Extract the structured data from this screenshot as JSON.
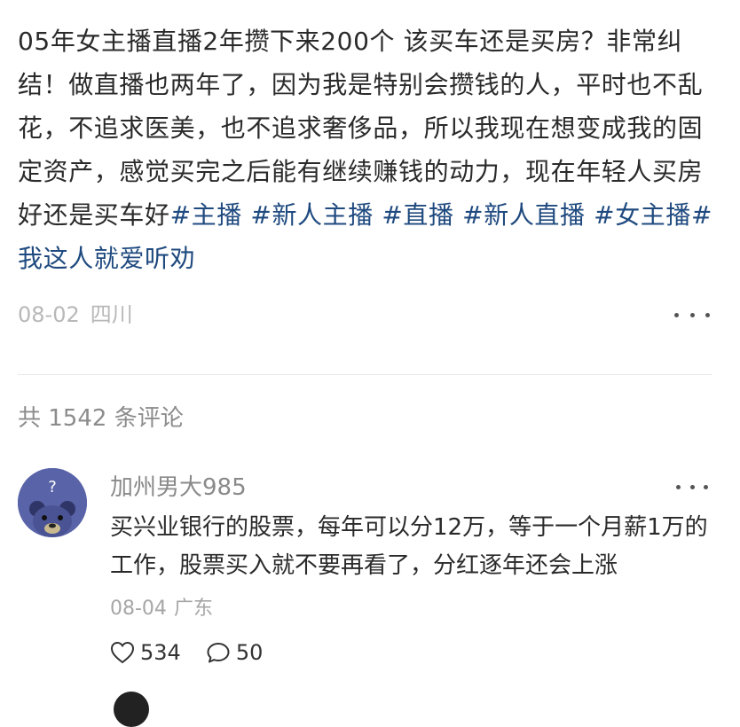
{
  "post": {
    "text": "05年女主播直播2年攒下来200个 该买车还是买房？非常纠结！做直播也两年了，因为我是特别会攒钱的人，平时也不乱花，不追求医美，也不追求奢侈品，所以我现在想变成我的固定资产，感觉买完之后能有继续赚钱的动力，现在年轻人买房好还是买车好",
    "tags": [
      "#主播",
      "#新人主播",
      "#直播",
      "#新人直播",
      "#女主播",
      "#我这人就爱听劝"
    ],
    "date": "08-02",
    "region": "四川"
  },
  "comments_header": "共 1542 条评论",
  "comment": {
    "author": "加州男大985",
    "text": "买兴业银行的股票，每年可以分12万，等于一个月薪1万的工作，股票买入就不要再看了，分红逐年还会上涨",
    "date": "08-04",
    "region": "广东",
    "likes": "534",
    "replies": "50"
  },
  "icons": {
    "like": "heart-icon",
    "reply": "comment-bubble-icon",
    "more": "more-dots-icon"
  },
  "colors": {
    "tag": "#1f4a7f",
    "muted": "#b8b8b8",
    "avatar_bg": "#5963a8"
  }
}
